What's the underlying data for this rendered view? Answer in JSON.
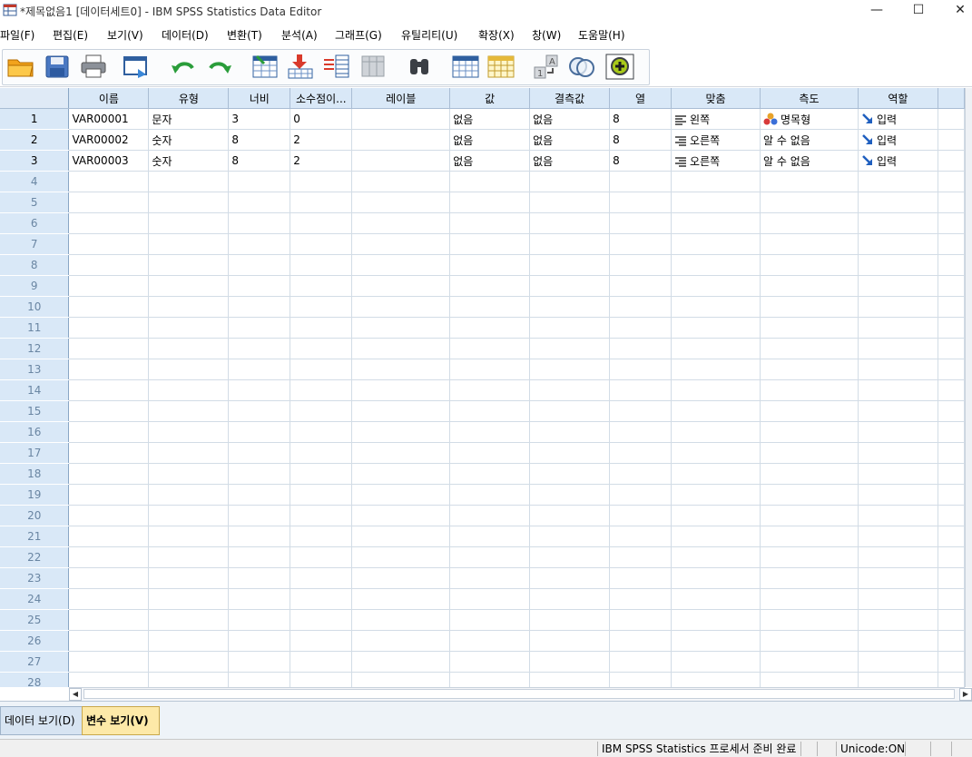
{
  "window": {
    "title": "*제목없음1 [데이터세트0] - IBM SPSS Statistics Data Editor",
    "minimize_label": "—",
    "maximize_label": "☐",
    "close_label": "✕"
  },
  "menu": [
    {
      "label": "파일(F)"
    },
    {
      "label": "편집(E)"
    },
    {
      "label": "보기(V)"
    },
    {
      "label": "데이터(D)"
    },
    {
      "label": "변환(T)"
    },
    {
      "label": "분석(A)"
    },
    {
      "label": "그래프(G)"
    },
    {
      "label": "유틸리티(U)"
    },
    {
      "label": "확장(X)"
    },
    {
      "label": "창(W)"
    },
    {
      "label": "도움말(H)"
    }
  ],
  "toolbar": [
    {
      "icon": "open-folder-icon"
    },
    {
      "icon": "save-icon"
    },
    {
      "icon": "print-icon"
    },
    {
      "icon": "dialog-recall-icon"
    },
    {
      "icon": "undo-icon"
    },
    {
      "icon": "redo-icon"
    },
    {
      "icon": "go-to-case-icon"
    },
    {
      "icon": "go-to-variable-icon"
    },
    {
      "icon": "variables-icon"
    },
    {
      "icon": "run-descriptives-icon"
    },
    {
      "icon": "find-icon"
    },
    {
      "icon": "insert-cases-icon"
    },
    {
      "icon": "insert-variable-icon"
    },
    {
      "icon": "value-labels-icon"
    },
    {
      "icon": "use-variable-sets-icon"
    },
    {
      "icon": "show-all-variables-icon"
    }
  ],
  "grid": {
    "columns": [
      "이름",
      "유형",
      "너비",
      "소수점이...",
      "레이블",
      "값",
      "결측값",
      "열",
      "맞춤",
      "측도",
      "역할"
    ],
    "rows": [
      {
        "num": "1",
        "cells": [
          "VAR00001",
          "문자",
          "3",
          "0",
          "",
          "없음",
          "없음",
          "8",
          "왼쪽",
          "명목형",
          "입력"
        ],
        "align_icon": "align-left-icon",
        "measure_icon": "nominal-icon"
      },
      {
        "num": "2",
        "cells": [
          "VAR00002",
          "숫자",
          "8",
          "2",
          "",
          "없음",
          "없음",
          "8",
          "오른쪽",
          "알 수 없음",
          "입력"
        ],
        "align_icon": "align-right-icon",
        "measure_icon": ""
      },
      {
        "num": "3",
        "cells": [
          "VAR00003",
          "숫자",
          "8",
          "2",
          "",
          "없음",
          "없음",
          "8",
          "오른쪽",
          "알 수 없음",
          "입력"
        ],
        "align_icon": "align-right-icon",
        "measure_icon": ""
      }
    ],
    "empty_row_numbers": [
      "4",
      "5",
      "6",
      "7",
      "8",
      "9",
      "10",
      "11",
      "12",
      "13",
      "14",
      "15",
      "16",
      "17",
      "18",
      "19",
      "20",
      "21",
      "22",
      "23",
      "24",
      "25",
      "26",
      "27",
      "28"
    ]
  },
  "tabs": {
    "data_view": "데이터 보기(D)",
    "variable_view": "변수 보기(V)"
  },
  "status": {
    "processor": "IBM SPSS Statistics 프로세서 준비 완료",
    "unicode": "Unicode:ON"
  },
  "colors": {
    "header_bg": "#d9e8f7",
    "active_tab": "#fde9a8",
    "role_arrow": "#1f5fbf"
  }
}
